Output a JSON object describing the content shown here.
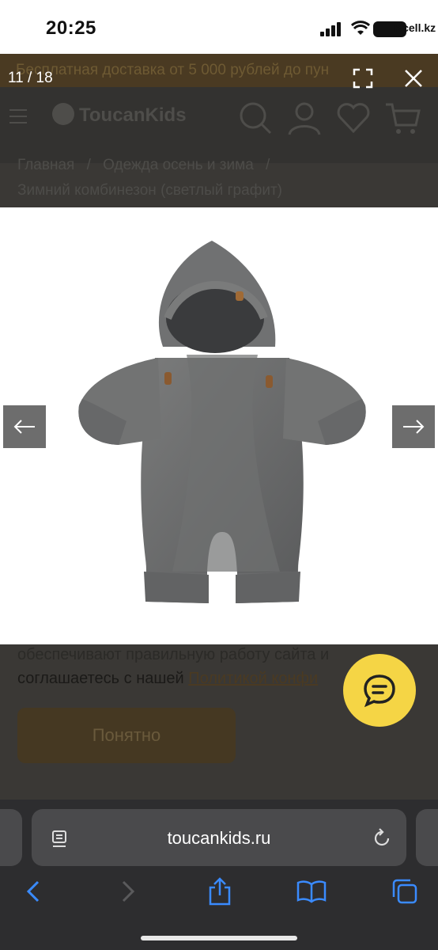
{
  "status_bar": {
    "time": "20:25",
    "carrier": "Kcell.kz"
  },
  "background_page": {
    "promo_text": "Бесплатная доставка от 5 000 рублей до пун",
    "logo": "ToucanKids",
    "breadcrumbs": {
      "home": "Главная",
      "sep1": "/",
      "category": "Одежда осень и зима",
      "sep2": "/"
    },
    "page_title": "Зимний комбинезон (светлый графит)",
    "cookie_text_1": "обеспечивают правильную работу сайта и",
    "cookie_text_2": "соглашаетесь с нашей",
    "cookie_link": "Политикой конфи",
    "accept_button": "Понятно"
  },
  "lightbox": {
    "counter": "11 / 18",
    "fullscreen_icon": "fullscreen-icon",
    "close_icon": "close-icon",
    "prev_icon": "arrow-left-icon",
    "next_icon": "arrow-right-icon"
  },
  "safari": {
    "url": "toucankids.ru",
    "reader_icon": "reader-icon",
    "reload_icon": "reload-icon"
  },
  "colors": {
    "chat_button": "#f5d545",
    "arrow_bg": "#6d6d6d",
    "safari_accent": "#3a8bff"
  }
}
